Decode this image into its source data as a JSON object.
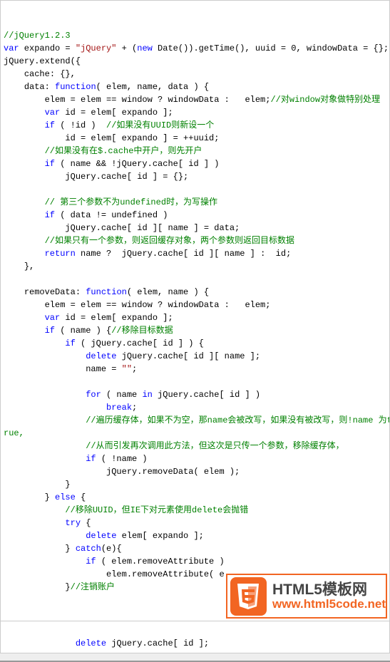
{
  "code": {
    "lines": [
      {
        "indent": 0,
        "parts": [
          {
            "t": "//jQuery1.2.3",
            "c": "cmt"
          }
        ]
      },
      {
        "indent": 0,
        "parts": [
          {
            "t": "var",
            "c": "kw"
          },
          {
            "t": " expando = "
          },
          {
            "t": "\"jQuery\"",
            "c": "str"
          },
          {
            "t": " + ("
          },
          {
            "t": "new",
            "c": "kw"
          },
          {
            "t": " Date()).getTime(), uuid = 0, windowData = {};"
          }
        ]
      },
      {
        "indent": 0,
        "parts": [
          {
            "t": "jQuery.extend({"
          }
        ]
      },
      {
        "indent": 1,
        "parts": [
          {
            "t": "cache: {},"
          }
        ]
      },
      {
        "indent": 1,
        "parts": [
          {
            "t": "data: "
          },
          {
            "t": "function",
            "c": "kw"
          },
          {
            "t": "( elem, name, data ) {"
          }
        ]
      },
      {
        "indent": 2,
        "parts": [
          {
            "t": "elem = elem == window ? windowData :   elem;"
          },
          {
            "t": "//对window对象做特别处理",
            "c": "cmt"
          }
        ]
      },
      {
        "indent": 2,
        "parts": [
          {
            "t": "var",
            "c": "kw"
          },
          {
            "t": " id = elem[ expando ];"
          }
        ]
      },
      {
        "indent": 2,
        "parts": [
          {
            "t": "if",
            "c": "kw"
          },
          {
            "t": " ( !id )  "
          },
          {
            "t": "//如果没有UUID则新设一个",
            "c": "cmt"
          }
        ]
      },
      {
        "indent": 3,
        "parts": [
          {
            "t": "id = elem[ expando ] = ++uuid;"
          }
        ]
      },
      {
        "indent": 2,
        "parts": [
          {
            "t": "//如果没有在$.cache中开户，则先开户",
            "c": "cmt"
          }
        ]
      },
      {
        "indent": 2,
        "parts": [
          {
            "t": "if",
            "c": "kw"
          },
          {
            "t": " ( name && !jQuery.cache[ id ] )"
          }
        ]
      },
      {
        "indent": 3,
        "parts": [
          {
            "t": "jQuery.cache[ id ] = {};"
          }
        ]
      },
      {
        "indent": 0,
        "parts": [
          {
            "t": " "
          }
        ]
      },
      {
        "indent": 2,
        "parts": [
          {
            "t": "// 第三个参数不为undefined时，为写操作",
            "c": "cmt"
          }
        ]
      },
      {
        "indent": 2,
        "parts": [
          {
            "t": "if",
            "c": "kw"
          },
          {
            "t": " ( data != undefined )"
          }
        ]
      },
      {
        "indent": 3,
        "parts": [
          {
            "t": "jQuery.cache[ id ][ name ] = data;"
          }
        ]
      },
      {
        "indent": 2,
        "parts": [
          {
            "t": "//如果只有一个参数，则返回缓存对象，两个参数则返回目标数据",
            "c": "cmt"
          }
        ]
      },
      {
        "indent": 2,
        "parts": [
          {
            "t": "return",
            "c": "kw"
          },
          {
            "t": " name ?  jQuery.cache[ id ][ name ] :  id;"
          }
        ]
      },
      {
        "indent": 1,
        "parts": [
          {
            "t": "},"
          }
        ]
      },
      {
        "indent": 0,
        "parts": [
          {
            "t": " "
          }
        ]
      },
      {
        "indent": 1,
        "parts": [
          {
            "t": "removeData: "
          },
          {
            "t": "function",
            "c": "kw"
          },
          {
            "t": "( elem, name ) {"
          }
        ]
      },
      {
        "indent": 2,
        "parts": [
          {
            "t": "elem = elem == window ? windowData :   elem;"
          }
        ]
      },
      {
        "indent": 2,
        "parts": [
          {
            "t": "var",
            "c": "kw"
          },
          {
            "t": " id = elem[ expando ];"
          }
        ]
      },
      {
        "indent": 2,
        "parts": [
          {
            "t": "if",
            "c": "kw"
          },
          {
            "t": " ( name ) {"
          },
          {
            "t": "//移除目标数据",
            "c": "cmt"
          }
        ]
      },
      {
        "indent": 3,
        "parts": [
          {
            "t": "if",
            "c": "kw"
          },
          {
            "t": " ( jQuery.cache[ id ] ) {"
          }
        ]
      },
      {
        "indent": 4,
        "parts": [
          {
            "t": "delete",
            "c": "kw"
          },
          {
            "t": " jQuery.cache[ id ][ name ];"
          }
        ]
      },
      {
        "indent": 4,
        "parts": [
          {
            "t": "name = "
          },
          {
            "t": "\"\"",
            "c": "str"
          },
          {
            "t": ";"
          }
        ]
      },
      {
        "indent": 0,
        "parts": [
          {
            "t": " "
          }
        ]
      },
      {
        "indent": 4,
        "parts": [
          {
            "t": "for",
            "c": "kw"
          },
          {
            "t": " ( name "
          },
          {
            "t": "in",
            "c": "kw"
          },
          {
            "t": " jQuery.cache[ id ] )"
          }
        ]
      },
      {
        "indent": 5,
        "parts": [
          {
            "t": "break",
            "c": "kw"
          },
          {
            "t": ";"
          }
        ]
      },
      {
        "indent": 4,
        "parts": [
          {
            "t": "//遍历缓存体，如果不为空，那name会被改写，如果没有被改写，则!name 为t",
            "c": "cmt"
          }
        ]
      },
      {
        "indent": 0,
        "parts": [
          {
            "t": "rue,",
            "c": "cmt"
          }
        ]
      },
      {
        "indent": 4,
        "parts": [
          {
            "t": "//从而引发再次调用此方法，但这次是只传一个参数，移除缓存体，",
            "c": "cmt"
          }
        ]
      },
      {
        "indent": 4,
        "parts": [
          {
            "t": "if",
            "c": "kw"
          },
          {
            "t": " ( !name )"
          }
        ]
      },
      {
        "indent": 5,
        "parts": [
          {
            "t": "jQuery.removeData( elem );"
          }
        ]
      },
      {
        "indent": 3,
        "parts": [
          {
            "t": "}"
          }
        ]
      },
      {
        "indent": 2,
        "parts": [
          {
            "t": "} "
          },
          {
            "t": "else",
            "c": "kw"
          },
          {
            "t": " {"
          }
        ]
      },
      {
        "indent": 3,
        "parts": [
          {
            "t": "//移除UUID，但IE下对元素使用delete会抛错",
            "c": "cmt"
          }
        ]
      },
      {
        "indent": 3,
        "parts": [
          {
            "t": "try",
            "c": "kw"
          },
          {
            "t": " {"
          }
        ]
      },
      {
        "indent": 4,
        "parts": [
          {
            "t": "delete",
            "c": "kw"
          },
          {
            "t": " elem[ expando ];"
          }
        ]
      },
      {
        "indent": 3,
        "parts": [
          {
            "t": "} "
          },
          {
            "t": "catch",
            "c": "kw"
          },
          {
            "t": "(e){"
          }
        ]
      },
      {
        "indent": 4,
        "parts": [
          {
            "t": "if",
            "c": "kw"
          },
          {
            "t": " ( elem.removeAttribute )"
          }
        ]
      },
      {
        "indent": 5,
        "parts": [
          {
            "t": "elem.removeAttribute( e"
          }
        ]
      },
      {
        "indent": 3,
        "parts": [
          {
            "t": "}"
          },
          {
            "t": "//注销账户",
            "c": "cmt"
          }
        ]
      }
    ],
    "bottomLine": {
      "indent": 3,
      "parts": [
        {
          "t": "delete",
          "c": "kw"
        },
        {
          "t": " jQuery.cache[ id ];"
        }
      ]
    }
  },
  "logo": {
    "line1": "HTML5模板网",
    "line2": "www.html5code.net"
  }
}
